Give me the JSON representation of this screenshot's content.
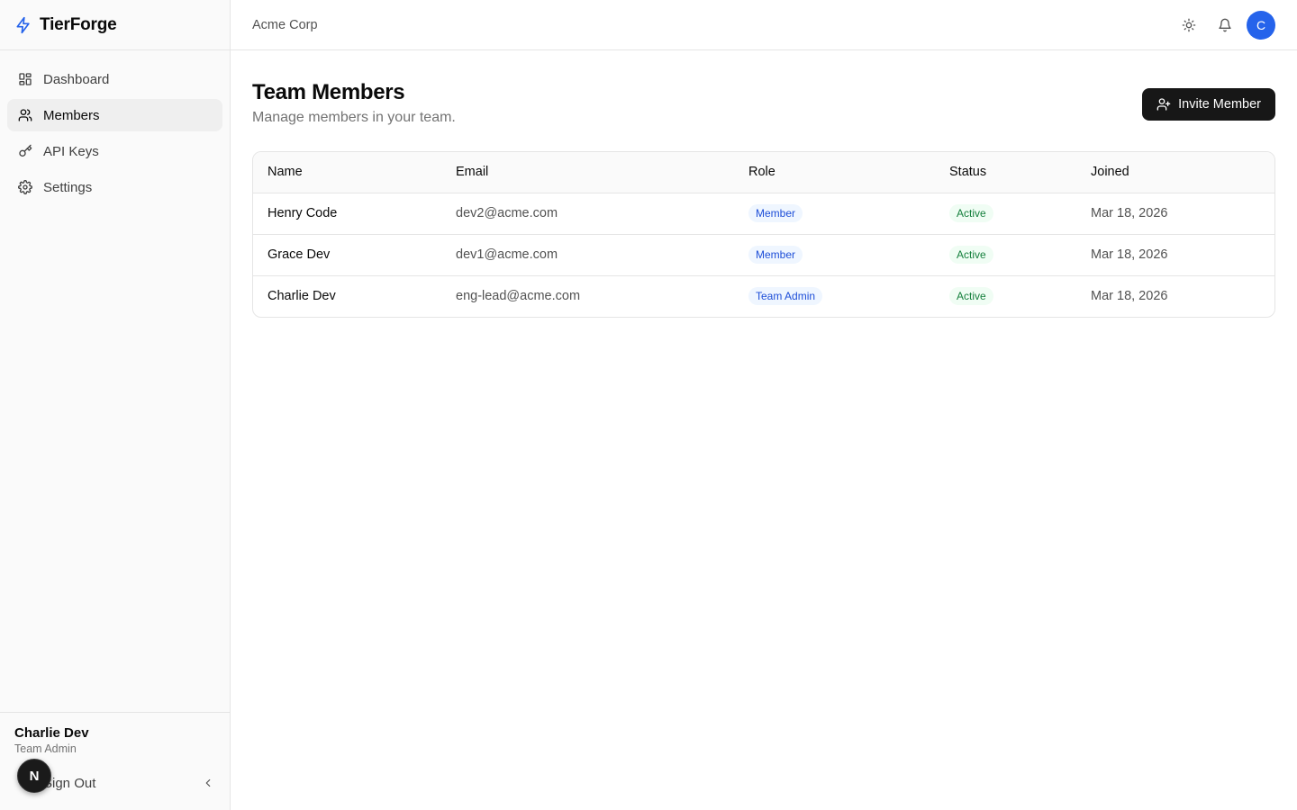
{
  "brand": {
    "name": "TierForge",
    "icon": "lightning-bolt-icon",
    "accent": "#2563eb"
  },
  "sidebar": {
    "items": [
      {
        "label": "Dashboard",
        "icon": "dashboard-grid-icon",
        "active": false
      },
      {
        "label": "Members",
        "icon": "users-icon",
        "active": true
      },
      {
        "label": "API Keys",
        "icon": "key-icon",
        "active": false
      },
      {
        "label": "Settings",
        "icon": "gear-icon",
        "active": false
      }
    ],
    "user": {
      "name": "Charlie Dev",
      "role": "Team Admin"
    },
    "sign_out_label": "Sign Out",
    "dev_badge": "N"
  },
  "topbar": {
    "org_name": "Acme Corp",
    "avatar_initial": "C",
    "avatar_color": "#2563eb"
  },
  "page": {
    "title": "Team Members",
    "subtitle": "Manage members in your team.",
    "invite_label": "Invite Member"
  },
  "table": {
    "columns": [
      "Name",
      "Email",
      "Role",
      "Status",
      "Joined"
    ],
    "rows": [
      {
        "name": "Henry Code",
        "email": "dev2@acme.com",
        "role": "Member",
        "status": "Active",
        "joined": "Mar 18, 2026"
      },
      {
        "name": "Grace Dev",
        "email": "dev1@acme.com",
        "role": "Member",
        "status": "Active",
        "joined": "Mar 18, 2026"
      },
      {
        "name": "Charlie Dev",
        "email": "eng-lead@acme.com",
        "role": "Team Admin",
        "status": "Active",
        "joined": "Mar 18, 2026"
      }
    ]
  }
}
